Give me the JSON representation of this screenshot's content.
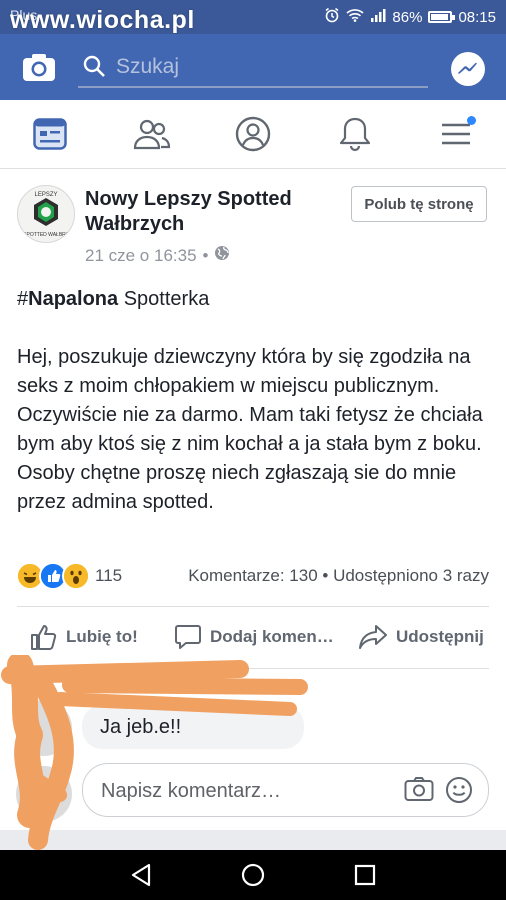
{
  "status_bar": {
    "carrier": "Plus",
    "watermark": "www.wiocha.pl",
    "battery": "86%",
    "time": "08:15"
  },
  "header": {
    "search_placeholder": "Szukaj",
    "icons": [
      "camera-icon",
      "search-icon",
      "messenger-icon"
    ],
    "accent_color": "#4267b2"
  },
  "nav": {
    "tabs": [
      "news-feed",
      "friends",
      "profile",
      "notifications",
      "menu"
    ],
    "active_tab": "news-feed"
  },
  "post": {
    "page_name": "Nowy Lepszy Spotted Wałbrzych",
    "avatar_text_top": "LEPSZY",
    "avatar_text_bottom": "SPOTTED WAŁBRZ",
    "timestamp": "21 cze o 16:35",
    "meta_separator": "•",
    "privacy_icon": "globe-icon",
    "like_page_label": "Polub tę stronę",
    "hashtag_symbol": "#",
    "hashtag_word": "Napalona",
    "hashtag_rest": " Spotterka",
    "body": "Hej, poszukuje dziewczyny która by się zgodziła na seks z moim chłopakiem w miejscu publicznym. Oczywiście nie za darmo. Mam taki fetysz że chciała bym aby ktoś się z nim kochał a ja stała bym z boku. Osoby chętne proszę niech zgłaszają sie do mnie przez admina spotted.",
    "reactions": [
      "haha",
      "like",
      "wow"
    ],
    "reaction_count": "115",
    "comments_shares": "Komentarze: 130 • Udostępniono 3 razy"
  },
  "actions": {
    "like": "Lubię to!",
    "comment": "Dodaj komen…",
    "share": "Udostępnij"
  },
  "comments": {
    "first_comment": "Ja jeb.e!!",
    "compose_placeholder": "Napisz komentarz…"
  },
  "colors": {
    "facebook_blue": "#4267b2",
    "status_bar": "#3b5998",
    "scribble": "#f0a060"
  }
}
